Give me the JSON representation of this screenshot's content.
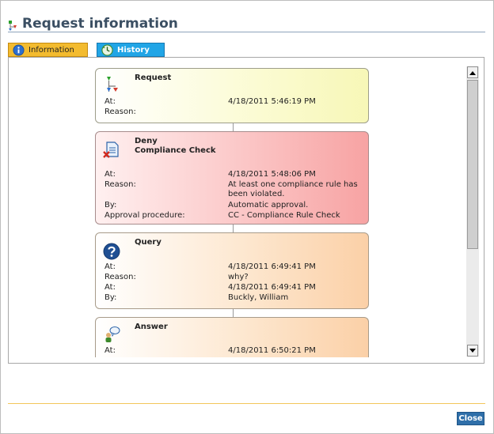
{
  "header": {
    "title": "Request information",
    "icon": "workflow-icon"
  },
  "tabs": [
    {
      "label": "Information",
      "icon": "info-icon",
      "active": false
    },
    {
      "label": "History",
      "icon": "history-icon",
      "active": true
    }
  ],
  "history": {
    "request": {
      "title": "Request",
      "rows": [
        {
          "label": "At:",
          "value": "4/18/2011 5:46:19 PM"
        },
        {
          "label": "Reason:",
          "value": ""
        }
      ]
    },
    "deny": {
      "title_line1": "Deny",
      "title_line2": "Compliance Check",
      "rows": [
        {
          "label": "At:",
          "value": "4/18/2011 5:48:06 PM"
        },
        {
          "label": "Reason:",
          "value": "At least one compliance rule has been violated."
        },
        {
          "label": "By:",
          "value": "Automatic approval."
        },
        {
          "label": "Approval procedure:",
          "value": "CC - Compliance Rule Check"
        }
      ]
    },
    "query": {
      "title": "Query",
      "rows": [
        {
          "label": "At:",
          "value": "4/18/2011 6:49:41 PM"
        },
        {
          "label": "Reason:",
          "value": "why?"
        },
        {
          "label": "At:",
          "value": "4/18/2011 6:49:41 PM"
        },
        {
          "label": "By:",
          "value": "Buckly, William"
        }
      ]
    },
    "answer": {
      "title": "Answer",
      "rows": [
        {
          "label": "At:",
          "value": "4/18/2011 6:50:21 PM"
        }
      ]
    }
  },
  "footer": {
    "close_label": "Close"
  },
  "colors": {
    "tab_info": "#f3bb2f",
    "tab_history": "#21a5e6",
    "close_button": "#2f6fa9",
    "deny_card": "#f7a3a3",
    "request_card": "#f7f7b7",
    "query_card": "#fbd0a7"
  }
}
